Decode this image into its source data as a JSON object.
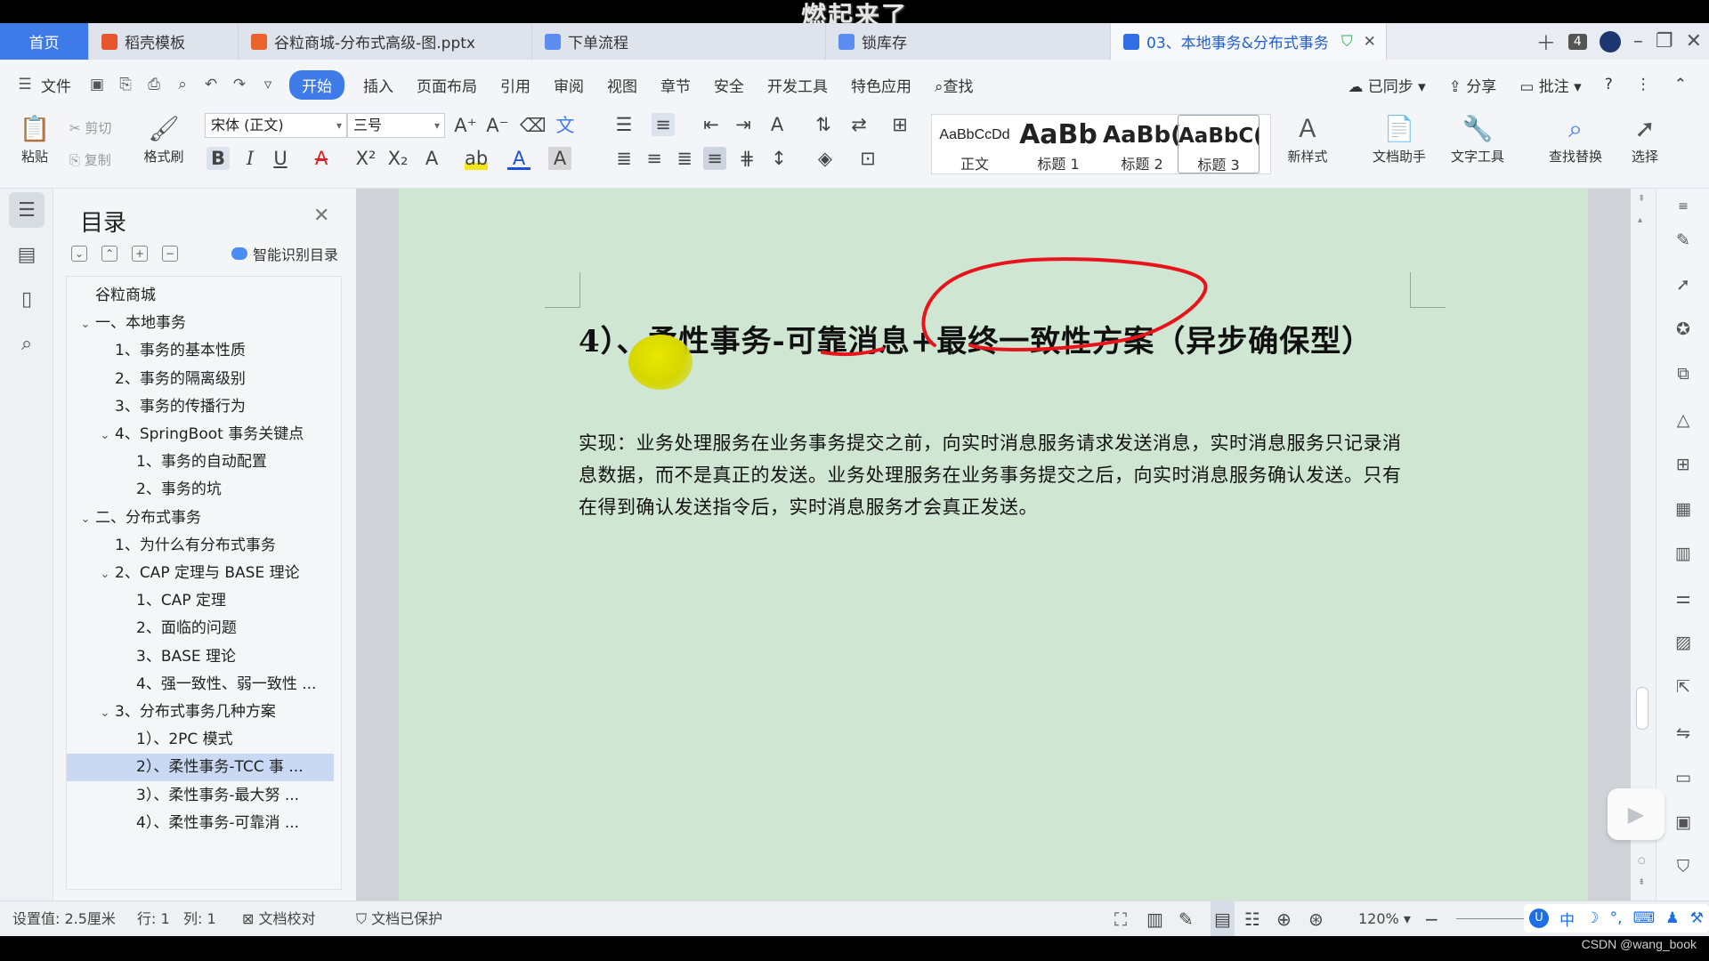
{
  "overlay_text": "燃起来了",
  "tabs": [
    {
      "label": "首页",
      "kind": "home"
    },
    {
      "label": "稻壳模板",
      "icon": "docer-icon",
      "color": "#e8542e"
    },
    {
      "label": "谷粒商城-分布式高级-图.pptx",
      "icon": "ppt-icon",
      "color": "#e8642a"
    },
    {
      "label": "下单流程",
      "icon": "flow-icon",
      "color": "#5b8ef0"
    },
    {
      "label": "锁库存",
      "icon": "flow-icon",
      "color": "#5b8ef0"
    },
    {
      "label": "03、本地事务&分布式事务",
      "icon": "word-icon",
      "color": "#2f6ee5",
      "active": true
    }
  ],
  "tab_count_badge": "4",
  "menu": {
    "file": "文件",
    "items": [
      "开始",
      "插入",
      "页面布局",
      "引用",
      "审阅",
      "视图",
      "章节",
      "安全",
      "开发工具",
      "特色应用"
    ],
    "active": "开始",
    "search": "查找",
    "synced": "已同步",
    "share": "分享",
    "annotate": "批注"
  },
  "ribbon": {
    "paste": "粘贴",
    "cut": "剪切",
    "copy": "复制",
    "format_painter": "格式刷",
    "font_name": "宋体 (正文)",
    "font_size": "三号",
    "styles": [
      {
        "preview": "AaBbCcDd",
        "name": "正文"
      },
      {
        "preview": "AaBb",
        "name": "标题 1"
      },
      {
        "preview": "AaBb(",
        "name": "标题 2"
      },
      {
        "preview": "AaBbC(",
        "name": "标题 3"
      }
    ],
    "new_style": "新样式",
    "doc_assistant": "文档助手",
    "text_tools": "文字工具",
    "find_replace": "查找替换",
    "select": "选择"
  },
  "toc": {
    "title": "目录",
    "smart_label": "智能识别目录",
    "items": [
      {
        "text": "谷粒商城",
        "level": 0,
        "chev": ""
      },
      {
        "text": "一、本地事务",
        "level": 0,
        "chev": "v"
      },
      {
        "text": "1、事务的基本性质",
        "level": 1,
        "chev": ""
      },
      {
        "text": "2、事务的隔离级别",
        "level": 1,
        "chev": ""
      },
      {
        "text": "3、事务的传播行为",
        "level": 1,
        "chev": ""
      },
      {
        "text": "4、SpringBoot 事务关键点",
        "level": 1,
        "chev": "v"
      },
      {
        "text": "1、事务的自动配置",
        "level": 2,
        "chev": ""
      },
      {
        "text": "2、事务的坑",
        "level": 2,
        "chev": ""
      },
      {
        "text": "二、分布式事务",
        "level": 0,
        "chev": "v"
      },
      {
        "text": "1、为什么有分布式事务",
        "level": 1,
        "chev": ""
      },
      {
        "text": "2、CAP 定理与 BASE 理论",
        "level": 1,
        "chev": "v"
      },
      {
        "text": "1、CAP 定理",
        "level": 2,
        "chev": ""
      },
      {
        "text": "2、面临的问题",
        "level": 2,
        "chev": ""
      },
      {
        "text": "3、BASE 理论",
        "level": 2,
        "chev": ""
      },
      {
        "text": "4、强一致性、弱一致性 ...",
        "level": 2,
        "chev": ""
      },
      {
        "text": "3、分布式事务几种方案",
        "level": 1,
        "chev": "v"
      },
      {
        "text": "1）、2PC 模式",
        "level": 2,
        "chev": ""
      },
      {
        "text": "2）、柔性事务-TCC 事 ...",
        "level": 2,
        "chev": "",
        "selected": true
      },
      {
        "text": "3）、柔性事务-最大努 ...",
        "level": 2,
        "chev": ""
      },
      {
        "text": "4）、柔性事务-可靠消 ...",
        "level": 2,
        "chev": ""
      }
    ]
  },
  "document": {
    "heading": "4）、柔性事务-可靠消息+最终一致性方案（异步确保型）",
    "paragraph": "实现：业务处理服务在业务事务提交之前，向实时消息服务请求发送消息，实时消息服务只记录消息数据，而不是真正的发送。业务处理服务在业务事务提交之后，向实时消息服务确认发送。只有在得到确认发送指令后，实时消息服务才会真正发送。",
    "annotation_color": "#e8141c",
    "page_color": "#cfe6d2"
  },
  "status": {
    "setting": "设置值: 2.5厘米",
    "row": "行: 1",
    "col": "列: 1",
    "proofread": "文档校对",
    "protected": "文档已保护",
    "zoom": "120%"
  },
  "ime": [
    "中",
    "⌨"
  ],
  "watermark": "CSDN @wang_book"
}
